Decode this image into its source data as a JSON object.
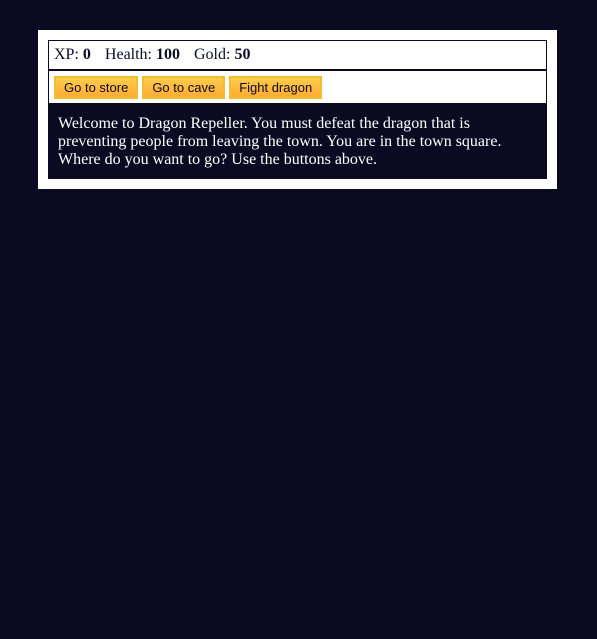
{
  "stats": {
    "xp_label": "XP:",
    "xp_value": "0",
    "health_label": "Health:",
    "health_value": "100",
    "gold_label": "Gold:",
    "gold_value": "50"
  },
  "controls": {
    "button1": "Go to store",
    "button2": "Go to cave",
    "button3": "Fight dragon"
  },
  "text": {
    "message": "Welcome to Dragon Repeller. You must defeat the dragon that is preventing people from leaving the town. You are in the town square. Where do you want to go? Use the buttons above."
  },
  "colors": {
    "background": "#0a0a23",
    "panel": "#ffffff",
    "button": "#feac32"
  }
}
